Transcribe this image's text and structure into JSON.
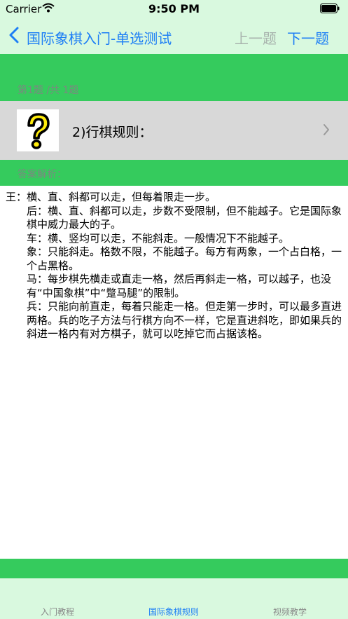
{
  "status": {
    "carrier": "Carrier",
    "time": "9:50 PM"
  },
  "nav": {
    "title": "国际象棋入门-单选测试",
    "prev": "上一题",
    "next": "下一题"
  },
  "progress": "第1题 /共 1题",
  "question": {
    "text": "2)行棋规则：",
    "image_icon": "question-mark-icon"
  },
  "answer_label": "答案解析：",
  "answer_paragraphs": [
    "王：横、直、斜都可以走，但每着限走一步。",
    "后：横、直、斜都可以走，步数不受限制，但不能越子。它是国际象棋中威力最大的子。",
    "车：横、竖均可以走，不能斜走。一般情况下不能越子。",
    "象：只能斜走。格数不限，不能越子。每方有两象，一个占白格，一个占黑格。",
    "马：每步棋先横走或直走一格，然后再斜走一格，可以越子，也没有“中国象棋”中“蹩马腿”的限制。",
    "兵：只能向前直走，每着只能走一格。但走第一步时，可以最多直进两格。兵的吃子方法与行棋方向不一样，它是直进斜吃，即如果兵的斜进一格内有对方棋子，就可以吃掉它而占据该格。"
  ],
  "tabs": [
    "入门教程",
    "国际象棋规则",
    "视频教学"
  ],
  "colors": {
    "accent": "#1e7ff5",
    "green": "#35cb5d",
    "light_green": "#d9f9df"
  }
}
